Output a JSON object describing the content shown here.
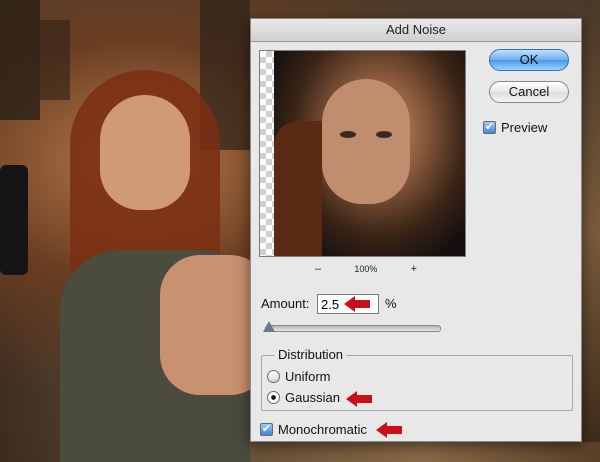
{
  "dialog": {
    "title": "Add Noise",
    "ok_label": "OK",
    "cancel_label": "Cancel",
    "preview_label": "Preview",
    "preview_checked": true,
    "zoom": {
      "minus": "–",
      "level": "100%",
      "plus": "+"
    },
    "amount": {
      "label": "Amount:",
      "value": "2.5",
      "unit": "%"
    },
    "distribution": {
      "title": "Distribution",
      "options": [
        {
          "label": "Uniform",
          "selected": false
        },
        {
          "label": "Gaussian",
          "selected": true
        }
      ]
    },
    "monochromatic": {
      "label": "Monochromatic",
      "checked": true
    },
    "check_mark": "✔"
  },
  "colors": {
    "annotation_arrow": "#c6111a",
    "ok_button": "#4b98e6"
  }
}
